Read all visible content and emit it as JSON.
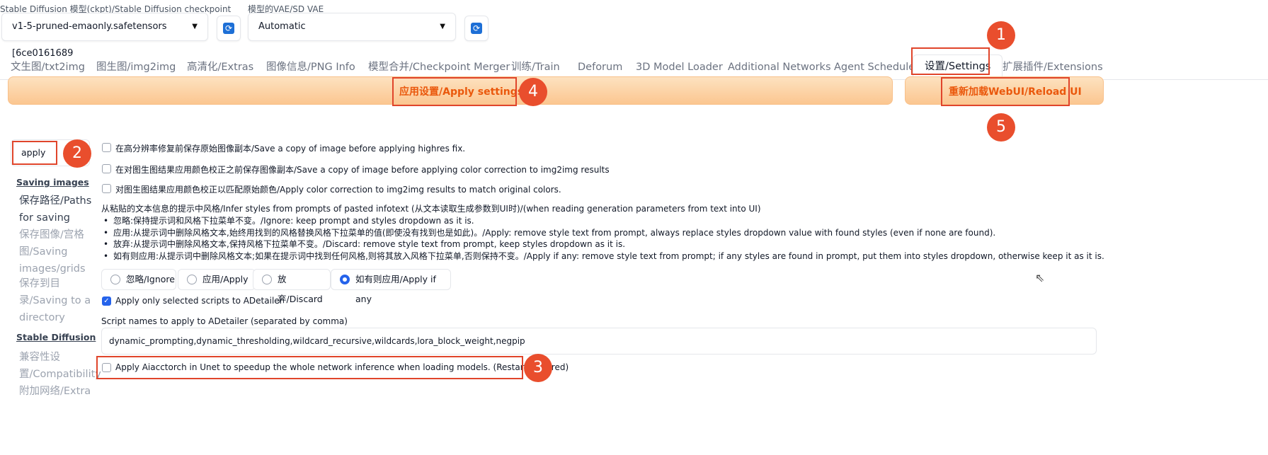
{
  "models": {
    "ckpt_label": "Stable Diffusion 模型(ckpt)/Stable Diffusion checkpoint",
    "ckpt_value": "v1-5-pruned-emaonly.safetensors [6ce0161689",
    "vae_label": "模型的VAE/SD VAE",
    "vae_value": "Automatic"
  },
  "tabs": [
    {
      "label": "文生图/txt2img"
    },
    {
      "label": "图生图/img2img"
    },
    {
      "label": "高清化/Extras"
    },
    {
      "label": "图像信息/PNG Info"
    },
    {
      "label": "模型合并/Checkpoint Merger"
    },
    {
      "label": "训练/Train"
    },
    {
      "label": "Deforum"
    },
    {
      "label": "3D Model Loader"
    },
    {
      "label": "Additional Networks"
    },
    {
      "label": "Agent Scheduler"
    },
    {
      "label": "设置/Settings"
    },
    {
      "label": "扩展插件/Extensions"
    }
  ],
  "buttons": {
    "apply": "应用设置/Apply settings",
    "reload": "重新加载WebUI/Reload UI"
  },
  "badges": [
    "1",
    "2",
    "3",
    "4",
    "5"
  ],
  "search": {
    "value": "apply"
  },
  "sidebar": {
    "section1": "Saving images",
    "items1": [
      "保存路径/Paths for saving",
      "保存图像/宫格图/Saving images/grids",
      "保存到目录/Saving to a directory"
    ],
    "section2": "Stable Diffusion",
    "items2": [
      "兼容性设置/Compatibility",
      "附加网络/Extra"
    ]
  },
  "settings": {
    "opt_highres": "在高分辨率修复前保存原始图像副本/Save a copy of image before applying highres fix.",
    "opt_colorcorr_save": "在对图生图结果应用颜色校正之前保存图像副本/Save a copy of image before applying color correction to img2img results",
    "opt_colorcorr_apply": "对图生图结果应用颜色校正以匹配原始颜色/Apply color correction to img2img results to match original colors.",
    "infer_title": "从粘贴的文本信息的提示中风格/Infer styles from prompts of pasted infotext (从文本读取生成参数到UI时)/(when reading generation parameters from text into UI)",
    "infer_bullets": [
      "忽略:保持提示词和风格下拉菜单不变。/Ignore: keep prompt and styles dropdown as it is.",
      "应用:从提示词中删除风格文本,始终用找到的风格替换风格下拉菜单的值(即使没有找到也是如此)。/Apply: remove style text from prompt, always replace styles dropdown value with found styles (even if none are found).",
      "放弃:从提示词中删除风格文本,保持风格下拉菜单不变。/Discard: remove style text from prompt, keep styles dropdown as it is.",
      "如有则应用:从提示词中删除风格文本;如果在提示词中找到任何风格,则将其放入风格下拉菜单,否则保持不变。/Apply if any: remove style text from prompt; if any styles are found in prompt, put them into styles dropdown, otherwise keep it as it is."
    ],
    "radio_options": [
      "忽略/Ignore",
      "应用/Apply",
      "放弃/Discard",
      "如有则应用/Apply if any"
    ],
    "radio_selected": "如有则应用/Apply if any",
    "adetailer_only": "Apply only selected scripts to ADetailer",
    "script_names_label": "Script names to apply to ADetailer (separated by comma)",
    "script_names_value": "dynamic_prompting,dynamic_thresholding,wildcard_recursive,wildcards,lora_block_weight,negpip",
    "aiacctorch": "Apply Aiacctorch in Unet to speedup the whole network inference when loading models. (Restart required)"
  }
}
